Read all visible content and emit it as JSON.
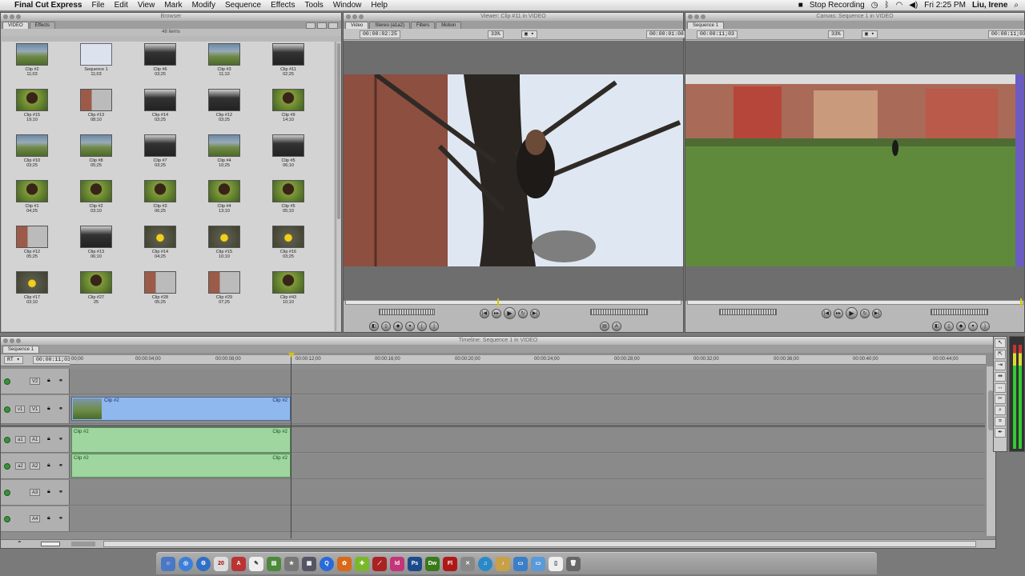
{
  "menubar": {
    "app_name": "Final Cut Express",
    "items": [
      "File",
      "Edit",
      "View",
      "Mark",
      "Modify",
      "Sequence",
      "Effects",
      "Tools",
      "Window",
      "Help"
    ],
    "stop_recording": "Stop Recording",
    "clock": "Fri 2:25 PM",
    "user": "Liu, Irene"
  },
  "browser": {
    "title": "Browser",
    "tabs": [
      "VIDEO",
      "Effects"
    ],
    "count": "48 items",
    "clips": [
      {
        "name": "Clip #2",
        "dur": "11;03",
        "kind": "field"
      },
      {
        "name": "Sequence 1",
        "dur": "11;03",
        "kind": "seq"
      },
      {
        "name": "Clip #6",
        "dur": "03;25",
        "kind": "dark"
      },
      {
        "name": "Clip #3",
        "dur": "11;10",
        "kind": "field"
      },
      {
        "name": "Clip #11",
        "dur": "02;25",
        "kind": "dark"
      },
      {
        "name": "Clip #15",
        "dur": "19;10",
        "kind": "person"
      },
      {
        "name": "Clip #13",
        "dur": "08;10",
        "kind": "brick"
      },
      {
        "name": "Clip #14",
        "dur": "03;25",
        "kind": "dark"
      },
      {
        "name": "Clip #12",
        "dur": "03;25",
        "kind": "dark"
      },
      {
        "name": "Clip #9",
        "dur": "14;10",
        "kind": "person"
      },
      {
        "name": "Clip #10",
        "dur": "03;25",
        "kind": "field"
      },
      {
        "name": "Clip #8",
        "dur": "05;25",
        "kind": "field"
      },
      {
        "name": "Clip #7",
        "dur": "03;25",
        "kind": "dark"
      },
      {
        "name": "Clip #4",
        "dur": "10;25",
        "kind": "field"
      },
      {
        "name": "Clip #5",
        "dur": "06;10",
        "kind": "dark"
      },
      {
        "name": "Clip #1",
        "dur": "04;25",
        "kind": "person"
      },
      {
        "name": "Clip #2",
        "dur": "03;10",
        "kind": "person"
      },
      {
        "name": "Clip #3",
        "dur": "06;25",
        "kind": "person"
      },
      {
        "name": "Clip #4",
        "dur": "13;10",
        "kind": "person"
      },
      {
        "name": "Clip #5",
        "dur": "05;10",
        "kind": "person"
      },
      {
        "name": "Clip #12",
        "dur": "05;25",
        "kind": "brick"
      },
      {
        "name": "Clip #13",
        "dur": "06;10",
        "kind": "dark"
      },
      {
        "name": "Clip #14",
        "dur": "04;25",
        "kind": "flower"
      },
      {
        "name": "Clip #15",
        "dur": "10;10",
        "kind": "flower"
      },
      {
        "name": "Clip #16",
        "dur": "03;25",
        "kind": "flower"
      },
      {
        "name": "Clip #17",
        "dur": "03;10",
        "kind": "flower"
      },
      {
        "name": "Clip #27",
        "dur": "25",
        "kind": "person"
      },
      {
        "name": "Clip #28",
        "dur": "05;25",
        "kind": "brick"
      },
      {
        "name": "Clip #29",
        "dur": "07;25",
        "kind": "brick"
      },
      {
        "name": "Clip #43",
        "dur": "10;10",
        "kind": "person"
      }
    ]
  },
  "viewer": {
    "title": "Viewer: Clip #11 in VIDEO",
    "tabs": [
      "Video",
      "Stereo (a1a2)",
      "Filters",
      "Motion"
    ],
    "duration": "00:00:02:25",
    "zoom": "33%",
    "current": "00:00:01:08"
  },
  "canvas": {
    "title": "Canvas: Sequence 1 in VIDEO",
    "tab": "Sequence 1",
    "duration": "00:00:11;03",
    "zoom": "33%",
    "current": "00:00:11;03"
  },
  "timeline": {
    "title": "Timeline: Sequence 1 in VIDEO",
    "tab": "Sequence 1",
    "rt": "RT ▾",
    "timecode": "00:00:11;03",
    "ticks": [
      "00;00",
      "00:00:04;00",
      "00:00:08;00",
      "00:00:12;00",
      "00:00:16;00",
      "00:00:20;00",
      "00:00:24;00",
      "00:00:28;00",
      "00:00:32;00",
      "00:00:36;00",
      "00:00:40;00",
      "00:00:44;00"
    ],
    "tracks": [
      "V2",
      "V1",
      "A1",
      "A2",
      "A3",
      "A4"
    ],
    "patch_v": "v1",
    "patch_a1": "a1",
    "patch_a2": "a2",
    "clip_label": "Clip #2"
  },
  "dock": {
    "ical_date": "20",
    "apps": [
      "Id",
      "Ps",
      "Dw",
      "Fl"
    ]
  }
}
